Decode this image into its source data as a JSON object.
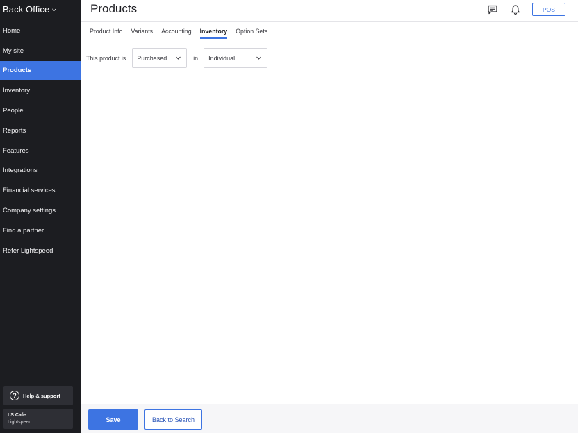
{
  "sidebar": {
    "brand": "Back Office",
    "items": [
      {
        "label": "Home"
      },
      {
        "label": "My site"
      },
      {
        "label": "Products"
      },
      {
        "label": "Inventory"
      },
      {
        "label": "People"
      },
      {
        "label": "Reports"
      },
      {
        "label": "Features"
      },
      {
        "label": "Integrations"
      },
      {
        "label": "Financial services"
      },
      {
        "label": "Company settings"
      },
      {
        "label": "Find a partner"
      },
      {
        "label": "Refer Lightspeed"
      }
    ],
    "active_index": 2,
    "help_label": "Help & support",
    "store_name": "LS Cafe",
    "store_sub": "Lightspeed"
  },
  "header": {
    "title": "Products",
    "pos_label": "POS"
  },
  "tabs": [
    {
      "label": "Product Info"
    },
    {
      "label": "Variants"
    },
    {
      "label": "Accounting"
    },
    {
      "label": "Inventory"
    },
    {
      "label": "Option Sets"
    }
  ],
  "active_tab_index": 3,
  "inventory": {
    "prefix_label": "This product is",
    "type_value": "Purchased",
    "in_label": "in",
    "unit_value": "Individual"
  },
  "footer": {
    "save_label": "Save",
    "back_label": "Back to Search"
  },
  "colors": {
    "accent": "#3d74e2",
    "sidebar_bg": "#1c1d21"
  }
}
